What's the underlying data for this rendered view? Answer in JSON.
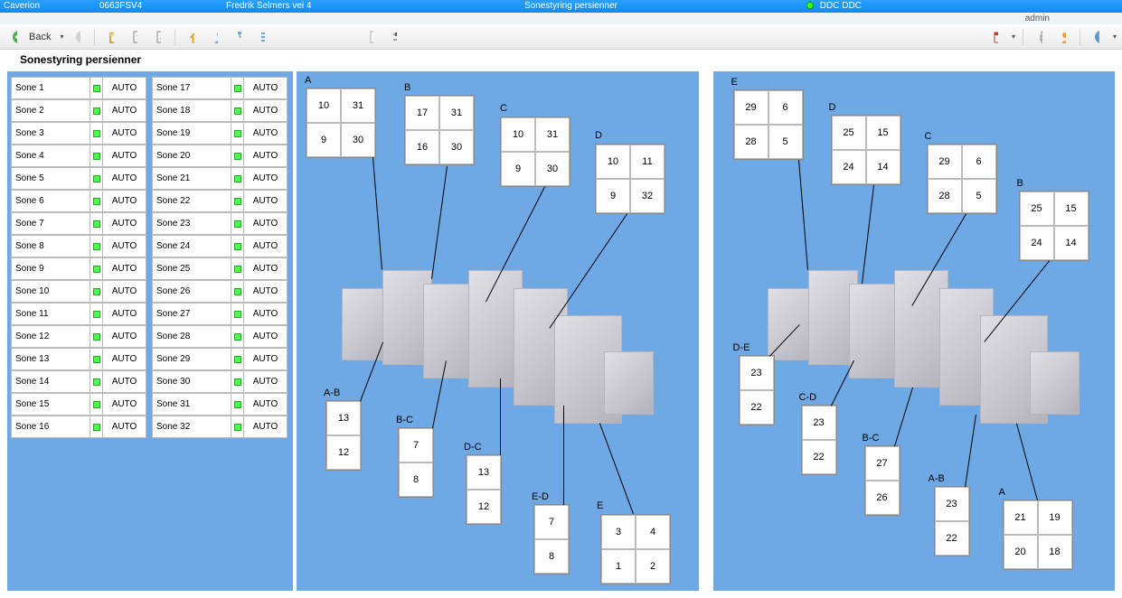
{
  "header": {
    "brand": "Caverion",
    "project_code": "0663FSV4",
    "building_name": "Fredrik Selmers vei 4",
    "page_name": "Sonestyring persienner",
    "status_label": "DDC DDC",
    "user": "admin"
  },
  "toolbar": {
    "back_label": "Back"
  },
  "page_title": "Sonestyring persienner",
  "zone_mode_label": "AUTO",
  "zones_left": [
    {
      "name": "Sone 1"
    },
    {
      "name": "Sone 2"
    },
    {
      "name": "Sone 3"
    },
    {
      "name": "Sone 4"
    },
    {
      "name": "Sone 5"
    },
    {
      "name": "Sone 6"
    },
    {
      "name": "Sone 7"
    },
    {
      "name": "Sone 8"
    },
    {
      "name": "Sone 9"
    },
    {
      "name": "Sone 10"
    },
    {
      "name": "Sone 11"
    },
    {
      "name": "Sone 12"
    },
    {
      "name": "Sone 13"
    },
    {
      "name": "Sone 14"
    },
    {
      "name": "Sone 15"
    },
    {
      "name": "Sone 16"
    }
  ],
  "zones_right": [
    {
      "name": "Sone 17"
    },
    {
      "name": "Sone 18"
    },
    {
      "name": "Sone 19"
    },
    {
      "name": "Sone 20"
    },
    {
      "name": "Sone 21"
    },
    {
      "name": "Sone 22"
    },
    {
      "name": "Sone 23"
    },
    {
      "name": "Sone 24"
    },
    {
      "name": "Sone 25"
    },
    {
      "name": "Sone 26"
    },
    {
      "name": "Sone 27"
    },
    {
      "name": "Sone 28"
    },
    {
      "name": "Sone 29"
    },
    {
      "name": "Sone 30"
    },
    {
      "name": "Sone 31"
    },
    {
      "name": "Sone 32"
    }
  ],
  "map_left": {
    "A": {
      "label": "A",
      "tl": "10",
      "tr": "31",
      "bl": "9",
      "br": "30"
    },
    "B": {
      "label": "B",
      "tl": "17",
      "tr": "31",
      "bl": "16",
      "br": "30"
    },
    "C": {
      "label": "C",
      "tl": "10",
      "tr": "31",
      "bl": "9",
      "br": "30"
    },
    "D": {
      "label": "D",
      "tl": "10",
      "tr": "11",
      "bl": "9",
      "br": "32"
    },
    "AB": {
      "label": "A-B",
      "t": "13",
      "b": "12"
    },
    "BC": {
      "label": "B-C",
      "t": "7",
      "b": "8"
    },
    "DC": {
      "label": "D-C",
      "t": "13",
      "b": "12"
    },
    "ED": {
      "label": "E-D",
      "t": "7",
      "b": "8"
    },
    "E": {
      "label": "E",
      "tl": "3",
      "tr": "4",
      "bl": "1",
      "br": "2"
    }
  },
  "map_right": {
    "E": {
      "label": "E",
      "tl": "29",
      "tr": "6",
      "bl": "28",
      "br": "5"
    },
    "D": {
      "label": "D",
      "tl": "25",
      "tr": "15",
      "bl": "24",
      "br": "14"
    },
    "C": {
      "label": "C",
      "tl": "29",
      "tr": "6",
      "bl": "28",
      "br": "5"
    },
    "B": {
      "label": "B",
      "tl": "25",
      "tr": "15",
      "bl": "24",
      "br": "14"
    },
    "DE": {
      "label": "D-E",
      "t": "23",
      "b": "22"
    },
    "CD": {
      "label": "C-D",
      "t": "23",
      "b": "22"
    },
    "BC": {
      "label": "B-C",
      "t": "27",
      "b": "26"
    },
    "AB": {
      "label": "A-B",
      "t": "23",
      "b": "22"
    },
    "A": {
      "label": "A",
      "tl": "21",
      "tr": "19",
      "bl": "20",
      "br": "18"
    }
  }
}
